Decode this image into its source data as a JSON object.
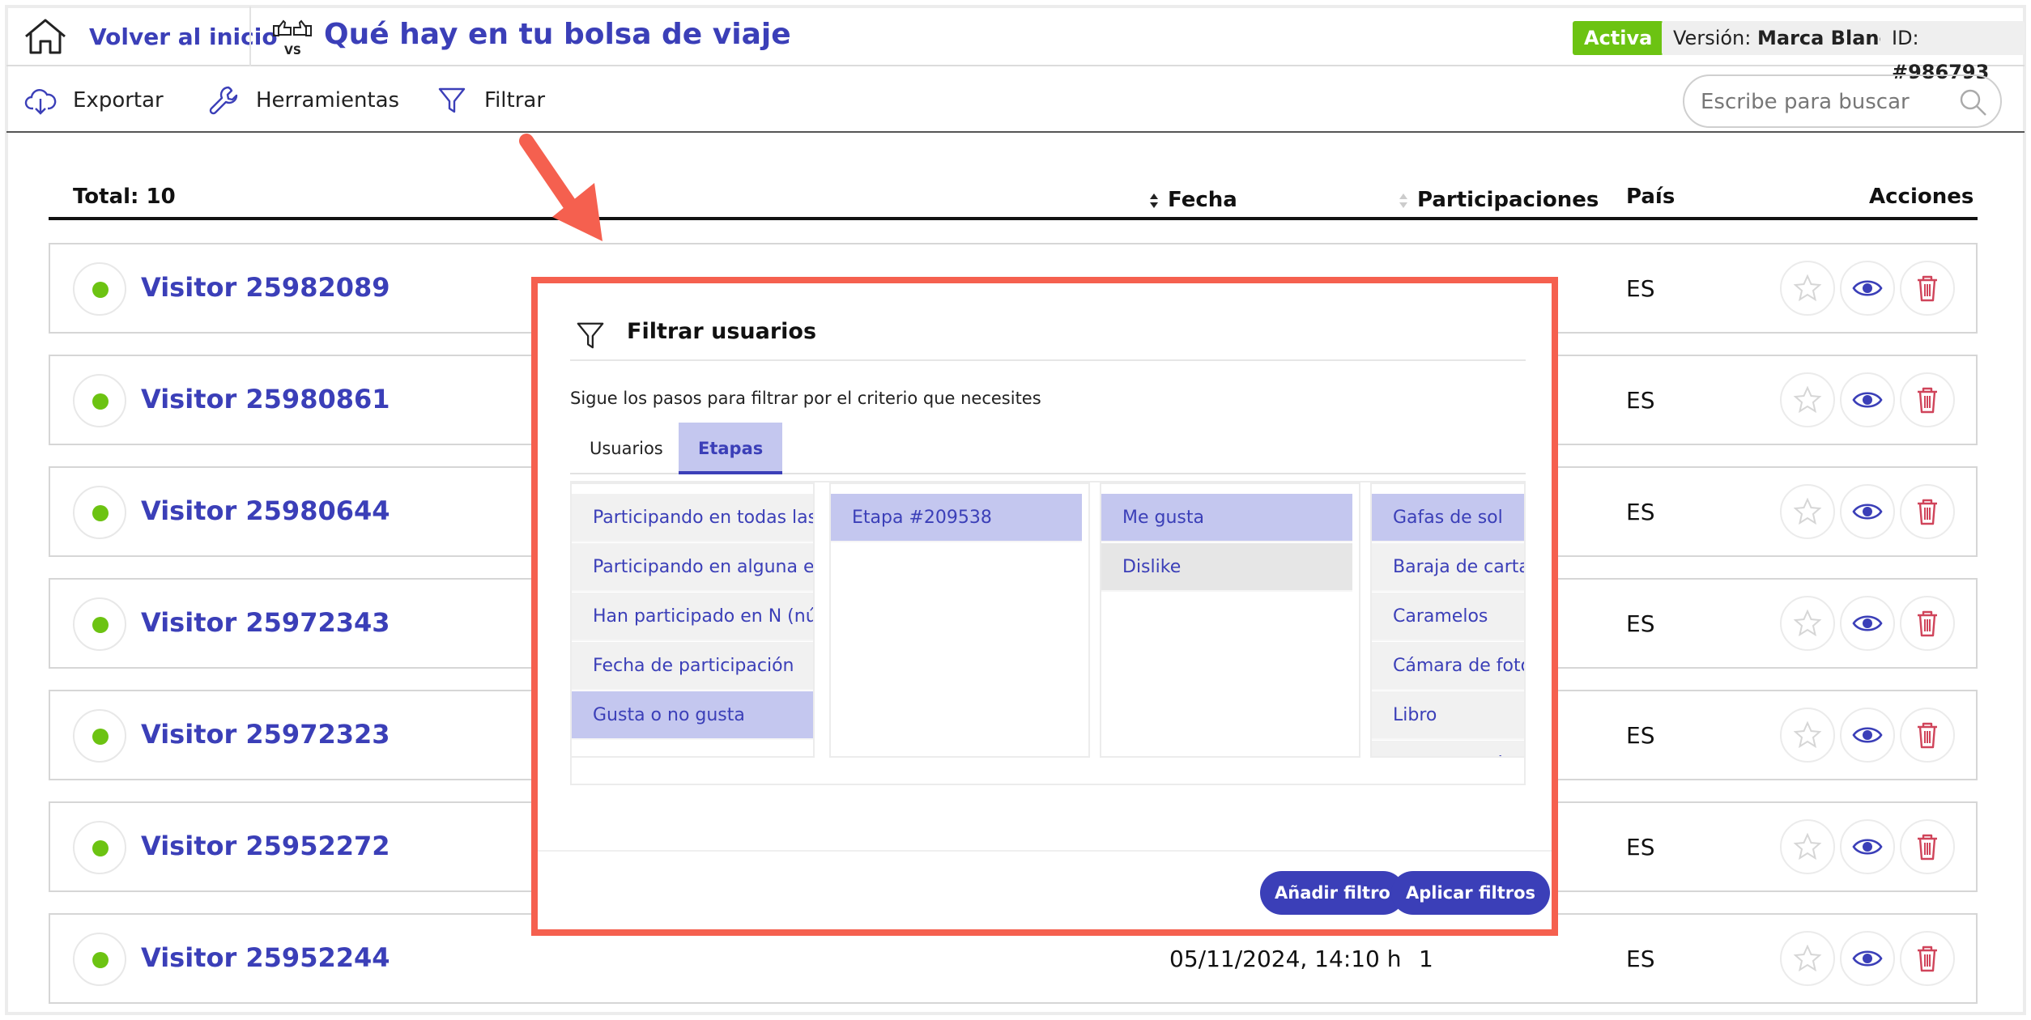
{
  "header": {
    "home_label": "Volver al inicio",
    "page_title": "Qué hay en tu bolsa de viaje",
    "status": "Activa",
    "version_prefix": "Versión:",
    "version_value": "Marca Blanca",
    "id_prefix": "ID:",
    "id_value": "#986793"
  },
  "toolbar": {
    "export_label": "Exportar",
    "tools_label": "Herramientas",
    "filter_label": "Filtrar",
    "search_placeholder": "Escribe para buscar"
  },
  "table": {
    "total": "Total: 10",
    "col_date": "Fecha",
    "col_participations": "Participaciones",
    "col_country": "País",
    "col_actions": "Acciones",
    "rows": [
      {
        "name": "Visitor 25982089",
        "date": "",
        "participations": "",
        "country": "ES"
      },
      {
        "name": "Visitor 25980861",
        "date": "",
        "participations": "",
        "country": "ES"
      },
      {
        "name": "Visitor 25980644",
        "date": "",
        "participations": "",
        "country": "ES"
      },
      {
        "name": "Visitor 25972343",
        "date": "",
        "participations": "",
        "country": "ES"
      },
      {
        "name": "Visitor 25972323",
        "date": "",
        "participations": "",
        "country": "ES"
      },
      {
        "name": "Visitor 25952272",
        "date": "",
        "participations": "",
        "country": "ES"
      },
      {
        "name": "Visitor 25952244",
        "date": "05/11/2024, 14:10 h",
        "participations": "1",
        "country": "ES"
      }
    ]
  },
  "modal": {
    "title": "Filtrar usuarios",
    "subtitle": "Sigue los pasos para filtrar por el criterio que necesites",
    "tabs": [
      "Usuarios",
      "Etapas"
    ],
    "active_tab": "Etapas",
    "col1": [
      "Participando en todas las et",
      "Participando en alguna etap",
      "Han participado en N (núme",
      "Fecha de participación",
      "Gusta o no gusta"
    ],
    "col2": [
      "Etapa #209538"
    ],
    "col3": [
      "Me gusta",
      "Dislike"
    ],
    "col4": [
      "Gafas de sol",
      "Baraja de cartas",
      "Caramelos",
      "Cámara de fotos",
      "Libro",
      "Libreta de lá"
    ],
    "add_filter": "Añadir filtro",
    "apply_filters": "Aplicar filtros"
  },
  "colors": {
    "accent": "#3b3fb8",
    "status_green": "#6cc312",
    "delete_red": "#d0445a",
    "highlight": "#f5604f",
    "selected_bg": "#c4c7ef"
  }
}
